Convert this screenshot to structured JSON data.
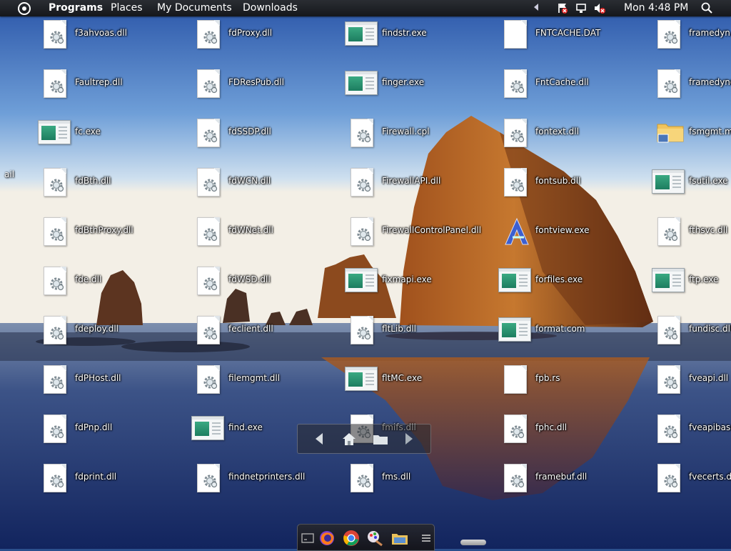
{
  "topbar": {
    "menu": [
      "Programs",
      "Places",
      "My Documents",
      "Downloads"
    ],
    "tray_icons": [
      "flag-alert-icon",
      "display-icon",
      "volume-muted-icon"
    ],
    "clock": "Mon 4:48 PM"
  },
  "desktop": {
    "edge_label": "ail",
    "icons": [
      {
        "label": "f3ahvoas.dll",
        "type": "dll"
      },
      {
        "label": "Faultrep.dll",
        "type": "dll"
      },
      {
        "label": "fc.exe",
        "type": "exe"
      },
      {
        "label": "fdBth.dll",
        "type": "dll"
      },
      {
        "label": "fdBthProxy.dll",
        "type": "dll"
      },
      {
        "label": "fde.dll",
        "type": "dll"
      },
      {
        "label": "fdeploy.dll",
        "type": "dll"
      },
      {
        "label": "fdPHost.dll",
        "type": "dll"
      },
      {
        "label": "fdPnp.dll",
        "type": "dll"
      },
      {
        "label": "fdprint.dll",
        "type": "dll"
      },
      {
        "label": "fdProxy.dll",
        "type": "dll"
      },
      {
        "label": "FDResPub.dll",
        "type": "dll"
      },
      {
        "label": "fdSSDP.dll",
        "type": "dll"
      },
      {
        "label": "fdWCN.dll",
        "type": "dll"
      },
      {
        "label": "fdWNet.dll",
        "type": "dll"
      },
      {
        "label": "fdWSD.dll",
        "type": "dll"
      },
      {
        "label": "feclient.dll",
        "type": "dll"
      },
      {
        "label": "filemgmt.dll",
        "type": "dll"
      },
      {
        "label": "find.exe",
        "type": "exe"
      },
      {
        "label": "findnetprinters.dll",
        "type": "dll"
      },
      {
        "label": "findstr.exe",
        "type": "exe"
      },
      {
        "label": "finger.exe",
        "type": "exe"
      },
      {
        "label": "Firewall.cpl",
        "type": "dll"
      },
      {
        "label": "FirewallAPI.dll",
        "type": "dll"
      },
      {
        "label": "FirewallControlPanel.dll",
        "type": "dll"
      },
      {
        "label": "fixmapi.exe",
        "type": "exe"
      },
      {
        "label": "fltLib.dll",
        "type": "dll"
      },
      {
        "label": "fltMC.exe",
        "type": "exe"
      },
      {
        "label": "fmifs.dll",
        "type": "dll"
      },
      {
        "label": "fms.dll",
        "type": "dll"
      },
      {
        "label": "FNTCACHE.DAT",
        "type": "doc"
      },
      {
        "label": "FntCache.dll",
        "type": "dll"
      },
      {
        "label": "fontext.dll",
        "type": "dll"
      },
      {
        "label": "fontsub.dll",
        "type": "dll"
      },
      {
        "label": "fontview.exe",
        "type": "fontview"
      },
      {
        "label": "forfiles.exe",
        "type": "exe"
      },
      {
        "label": "format.com",
        "type": "exe"
      },
      {
        "label": "fpb.rs",
        "type": "doc"
      },
      {
        "label": "fphc.dll",
        "type": "dll"
      },
      {
        "label": "framebuf.dll",
        "type": "dll"
      },
      {
        "label": "framedyn.dll",
        "type": "dll"
      },
      {
        "label": "framedynos.dll",
        "type": "dll"
      },
      {
        "label": "fsmgmt.msc",
        "type": "folder"
      },
      {
        "label": "fsutil.exe",
        "type": "exe"
      },
      {
        "label": "fthsvc.dll",
        "type": "dll"
      },
      {
        "label": "ftp.exe",
        "type": "exe"
      },
      {
        "label": "fundisc.dll",
        "type": "dll"
      },
      {
        "label": "fveapi.dll",
        "type": "dll"
      },
      {
        "label": "fveapibase.dll",
        "type": "dll"
      },
      {
        "label": "fvecerts.dll",
        "type": "dll"
      }
    ]
  },
  "nav_overlay": [
    "back-arrow-icon",
    "home-icon",
    "folder-icon",
    "forward-arrow-icon"
  ],
  "dock": [
    "terminal-icon",
    "firefox-icon",
    "chrome-icon",
    "paint-icon",
    "file-manager-icon",
    "menu-icon"
  ]
}
